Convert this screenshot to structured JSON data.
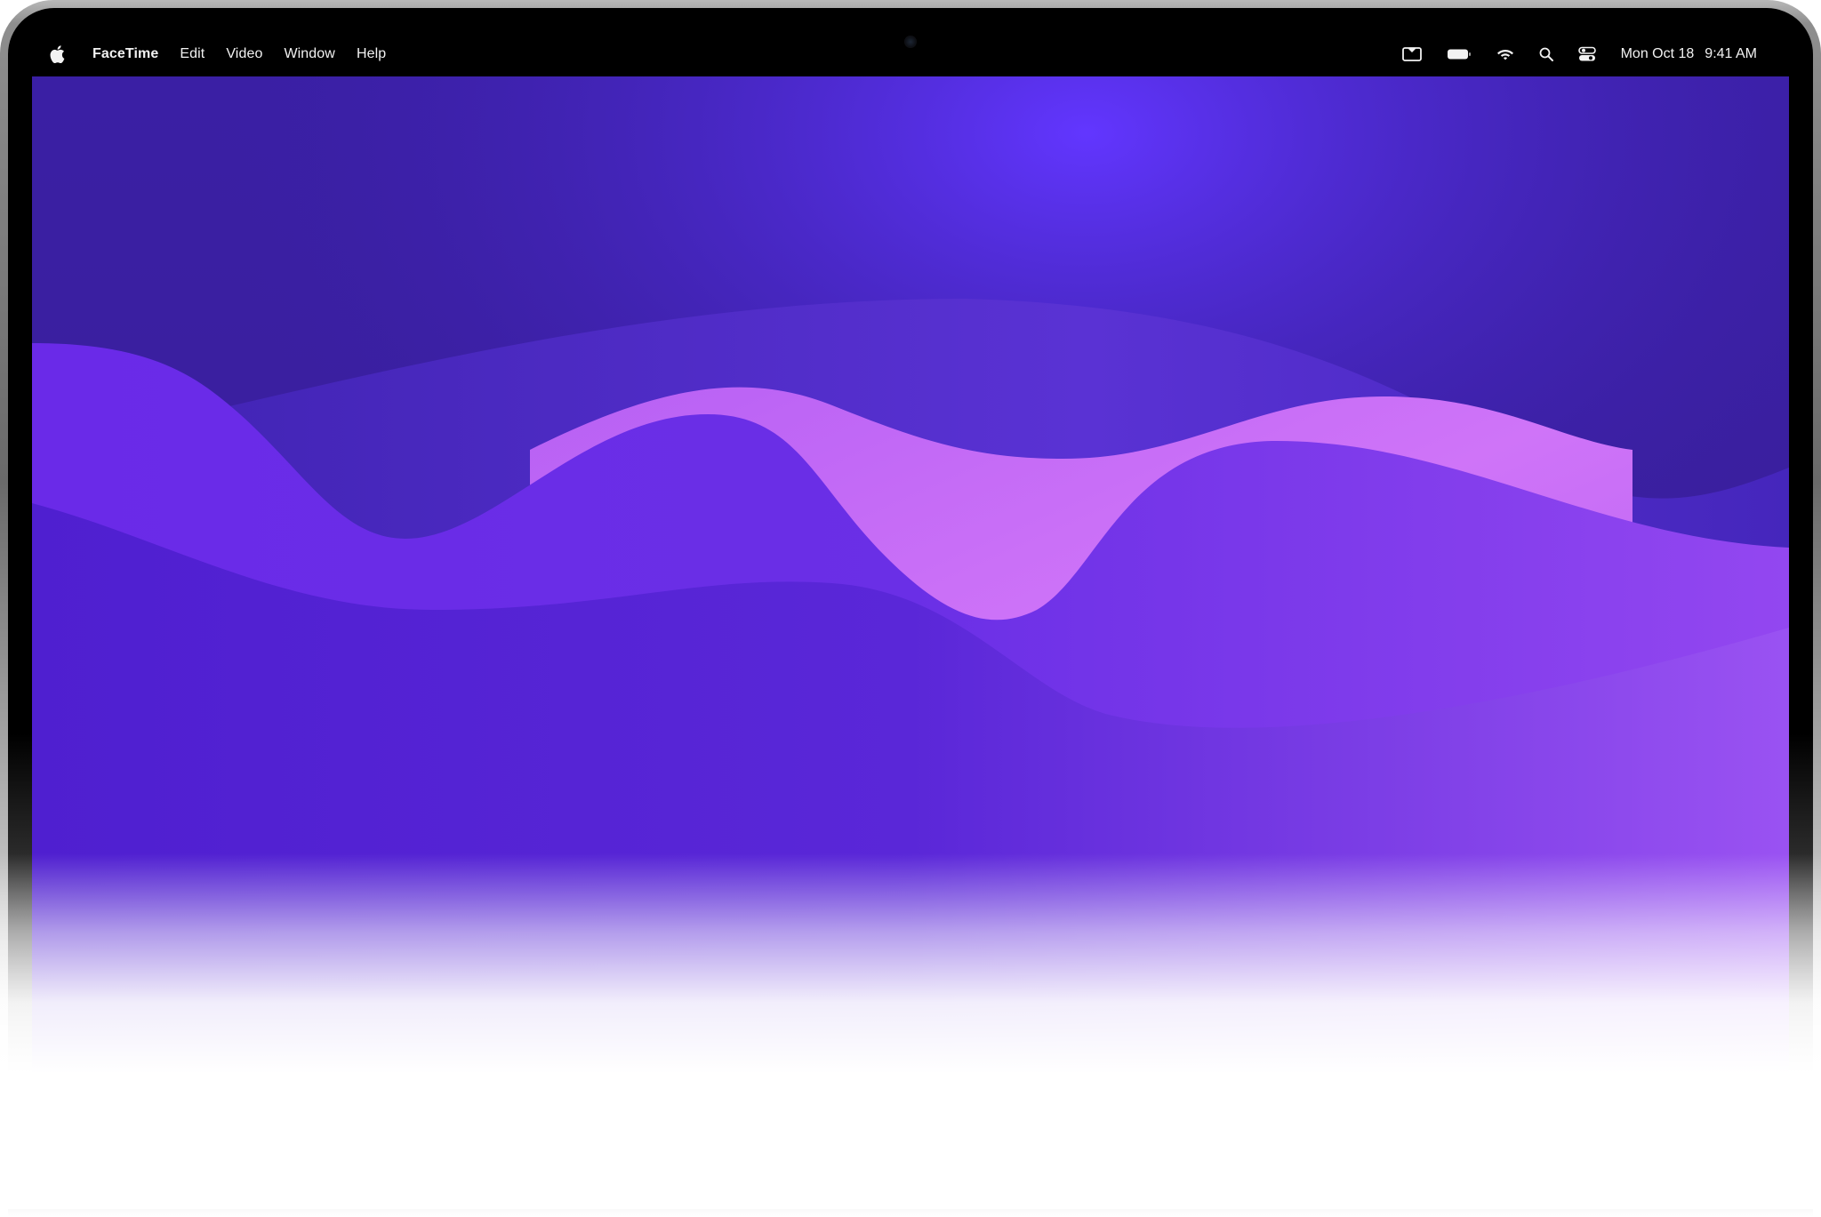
{
  "menubar": {
    "apple_icon": "apple-logo-icon",
    "app_name": "FaceTime",
    "items": [
      "Edit",
      "Video",
      "Window",
      "Help"
    ],
    "status_icons": [
      "screen-mirroring-icon",
      "battery-icon",
      "wifi-icon",
      "search-icon",
      "control-center-icon"
    ],
    "date": "Mon Oct 18",
    "time": "9:41 AM"
  },
  "wallpaper": {
    "colors": {
      "deep": "#3a1fa8",
      "mid": "#6a2fe6",
      "light": "#c86af6",
      "bright": "#5b35f0"
    }
  }
}
